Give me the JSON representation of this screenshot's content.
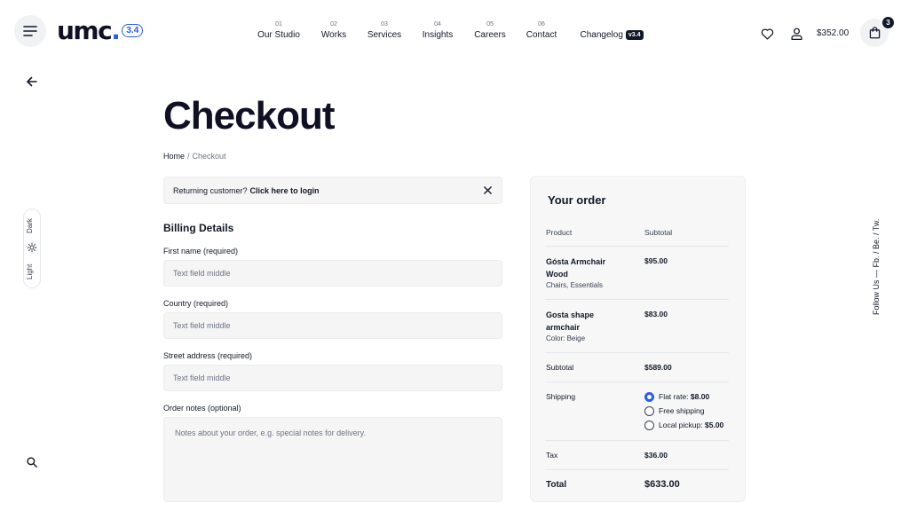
{
  "brand": {
    "name": "umc",
    "dot": ".",
    "version": "3.4"
  },
  "nav": [
    {
      "num": "01",
      "label": "Our Studio"
    },
    {
      "num": "02",
      "label": "Works"
    },
    {
      "num": "03",
      "label": "Services"
    },
    {
      "num": "04",
      "label": "Insights"
    },
    {
      "num": "05",
      "label": "Careers"
    },
    {
      "num": "06",
      "label": "Contact"
    },
    {
      "num": "",
      "label": "Changelog",
      "badge": "v3.4"
    }
  ],
  "header": {
    "cart_total": "$352.00",
    "cart_count": "3"
  },
  "theme": {
    "dark": "Dark",
    "light": "Light"
  },
  "social": {
    "text": "Follow Us — Fb. / Be. / Tw."
  },
  "page": {
    "title": "Checkout"
  },
  "breadcrumb": {
    "home": "Home",
    "separator": "/",
    "current": "Checkout"
  },
  "notice": {
    "prefix": "Returning customer?",
    "link": "Click here to login"
  },
  "billing": {
    "title": "Billing Details",
    "fields": [
      {
        "label": "First name (required)",
        "placeholder": "Text field middle"
      },
      {
        "label": "Country (required)",
        "placeholder": "Text field middle"
      },
      {
        "label": "Street address (required)",
        "placeholder": "Text field middle"
      }
    ],
    "notes": {
      "label": "Order notes (optional)",
      "placeholder": "Notes about your order, e.g. special notes for delivery."
    }
  },
  "order": {
    "title": "Your order",
    "col_product": "Product",
    "col_subtotal": "Subtotal",
    "items": [
      {
        "name_line1": "Gósta Armchair",
        "name_line2": "Wood",
        "meta": "Chairs, Essentials",
        "price": "$95.00"
      },
      {
        "name_line1": "Gosta shape",
        "name_line2": "armchair",
        "meta": "Color: Beige",
        "price": "$83.00"
      }
    ],
    "subtotal_label": "Subtotal",
    "subtotal_value": "$589.00",
    "shipping_label": "Shipping",
    "shipping_options": [
      {
        "label": "Flat rate:",
        "price": "$8.00",
        "selected": true
      },
      {
        "label": "Free shipping",
        "price": "",
        "selected": false
      },
      {
        "label": "Local pickup:",
        "price": "$5.00",
        "selected": false
      }
    ],
    "tax_label": "Tax",
    "tax_value": "$36.00",
    "total_label": "Total",
    "total_value": "$633.00"
  },
  "colors": {
    "accent": "#2b5ce6",
    "ink": "#0f1024",
    "field_bg": "#f5f5f6",
    "card_bg": "#f7f7f8"
  }
}
